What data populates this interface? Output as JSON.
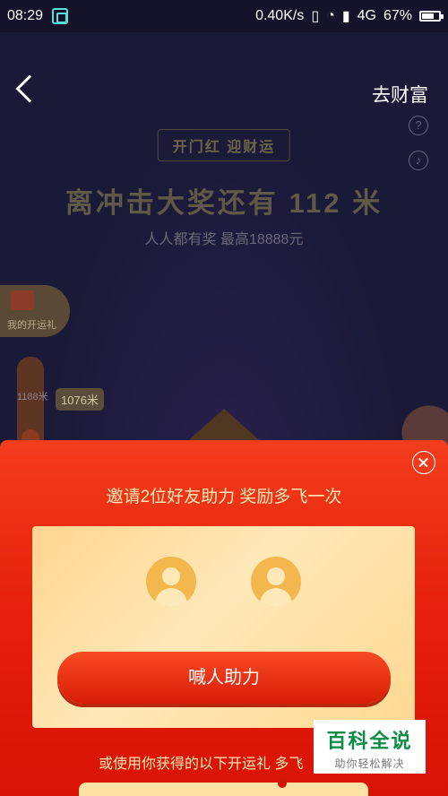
{
  "status_bar": {
    "time": "08:29",
    "network_speed": "0.40K/s",
    "network_type": "4G",
    "battery": "67%"
  },
  "header": {
    "top_right_link": "去财富",
    "help_icon": "?",
    "music_icon": "♪"
  },
  "game": {
    "banner": "开门红 迎财运",
    "headline": "离冲击大奖还有 112 米",
    "subline": "人人都有奖 最高18888元",
    "my_gift_label": "我的开运礼",
    "progress_top_label": "1188米",
    "progress_current_label": "1076米",
    "progress_fraction": 0.6
  },
  "modal": {
    "title": "邀请2位好友助力 奖励多飞一次",
    "cta_label": "喊人助力",
    "bottom_text": "或使用你获得的以下开运礼 多飞"
  },
  "watermark": {
    "title": "百科全说",
    "subtitle": "助你轻松解决"
  },
  "colors": {
    "sheet_red": "#e51f0b",
    "gold": "#ffe9b5",
    "card_gold": "#ffd58f",
    "background": "#1b1a38"
  }
}
